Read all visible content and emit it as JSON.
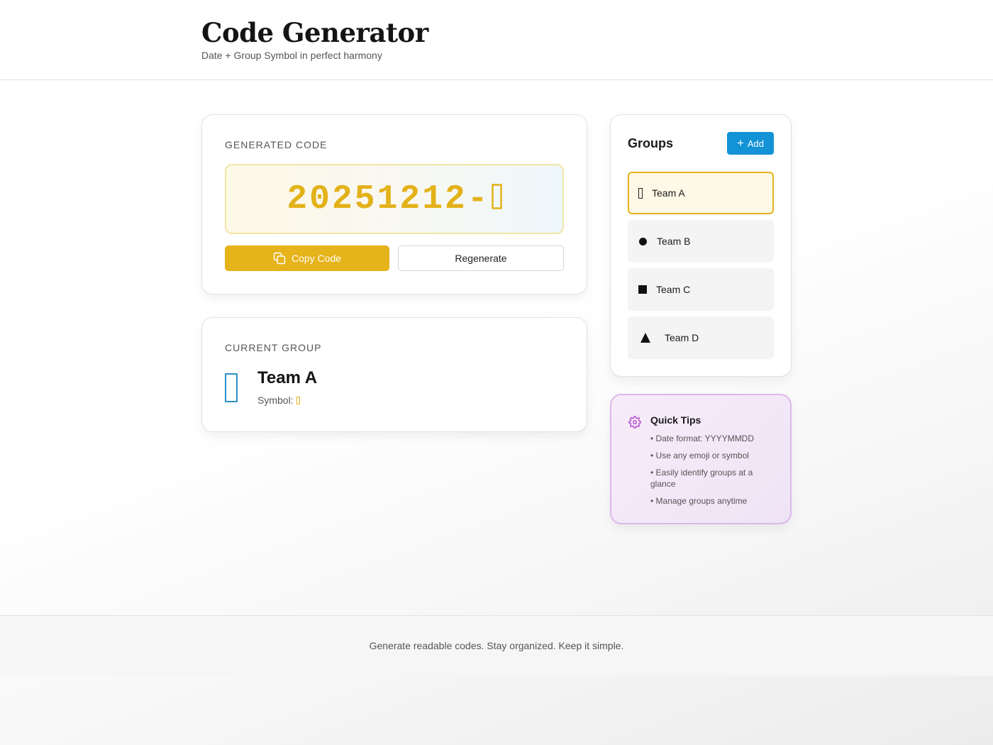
{
  "header": {
    "title": "Code Generator",
    "subtitle": "Date + Group Symbol in perfect harmony"
  },
  "generated_code": {
    "label": "GENERATED CODE",
    "code": "20251212-",
    "symbol_icon": "rectangle-outline-icon",
    "code_color": "#e3b21a",
    "copy_button_label": "Copy Code",
    "regenerate_button_label": "Regenerate"
  },
  "current_group": {
    "label": "CURRENT GROUP",
    "name": "Team A",
    "symbol_label": "Symbol:",
    "symbol_color": "#2a8fc6"
  },
  "groups": {
    "title": "Groups",
    "add_button_label": "Add",
    "accent": "#e5b31a",
    "items": [
      {
        "name": "Team A",
        "icon": "rectangle-outline-icon",
        "active": true
      },
      {
        "name": "Team B",
        "icon": "circle-icon",
        "active": false
      },
      {
        "name": "Team C",
        "icon": "square-icon",
        "active": false
      },
      {
        "name": "Team D",
        "icon": "triangle-icon",
        "active": false
      }
    ]
  },
  "tips": {
    "title": "Quick Tips",
    "items": [
      "• Date format: YYYYMMDD",
      "• Use any emoji or symbol",
      "• Easily identify groups at a glance",
      "• Manage groups anytime"
    ]
  },
  "footer": {
    "text": "Generate readable codes. Stay organized. Keep it simple."
  },
  "colors": {
    "primary_yellow": "#e5b31a",
    "add_blue": "#1392d6",
    "tips_border": "#dcb8ea"
  }
}
